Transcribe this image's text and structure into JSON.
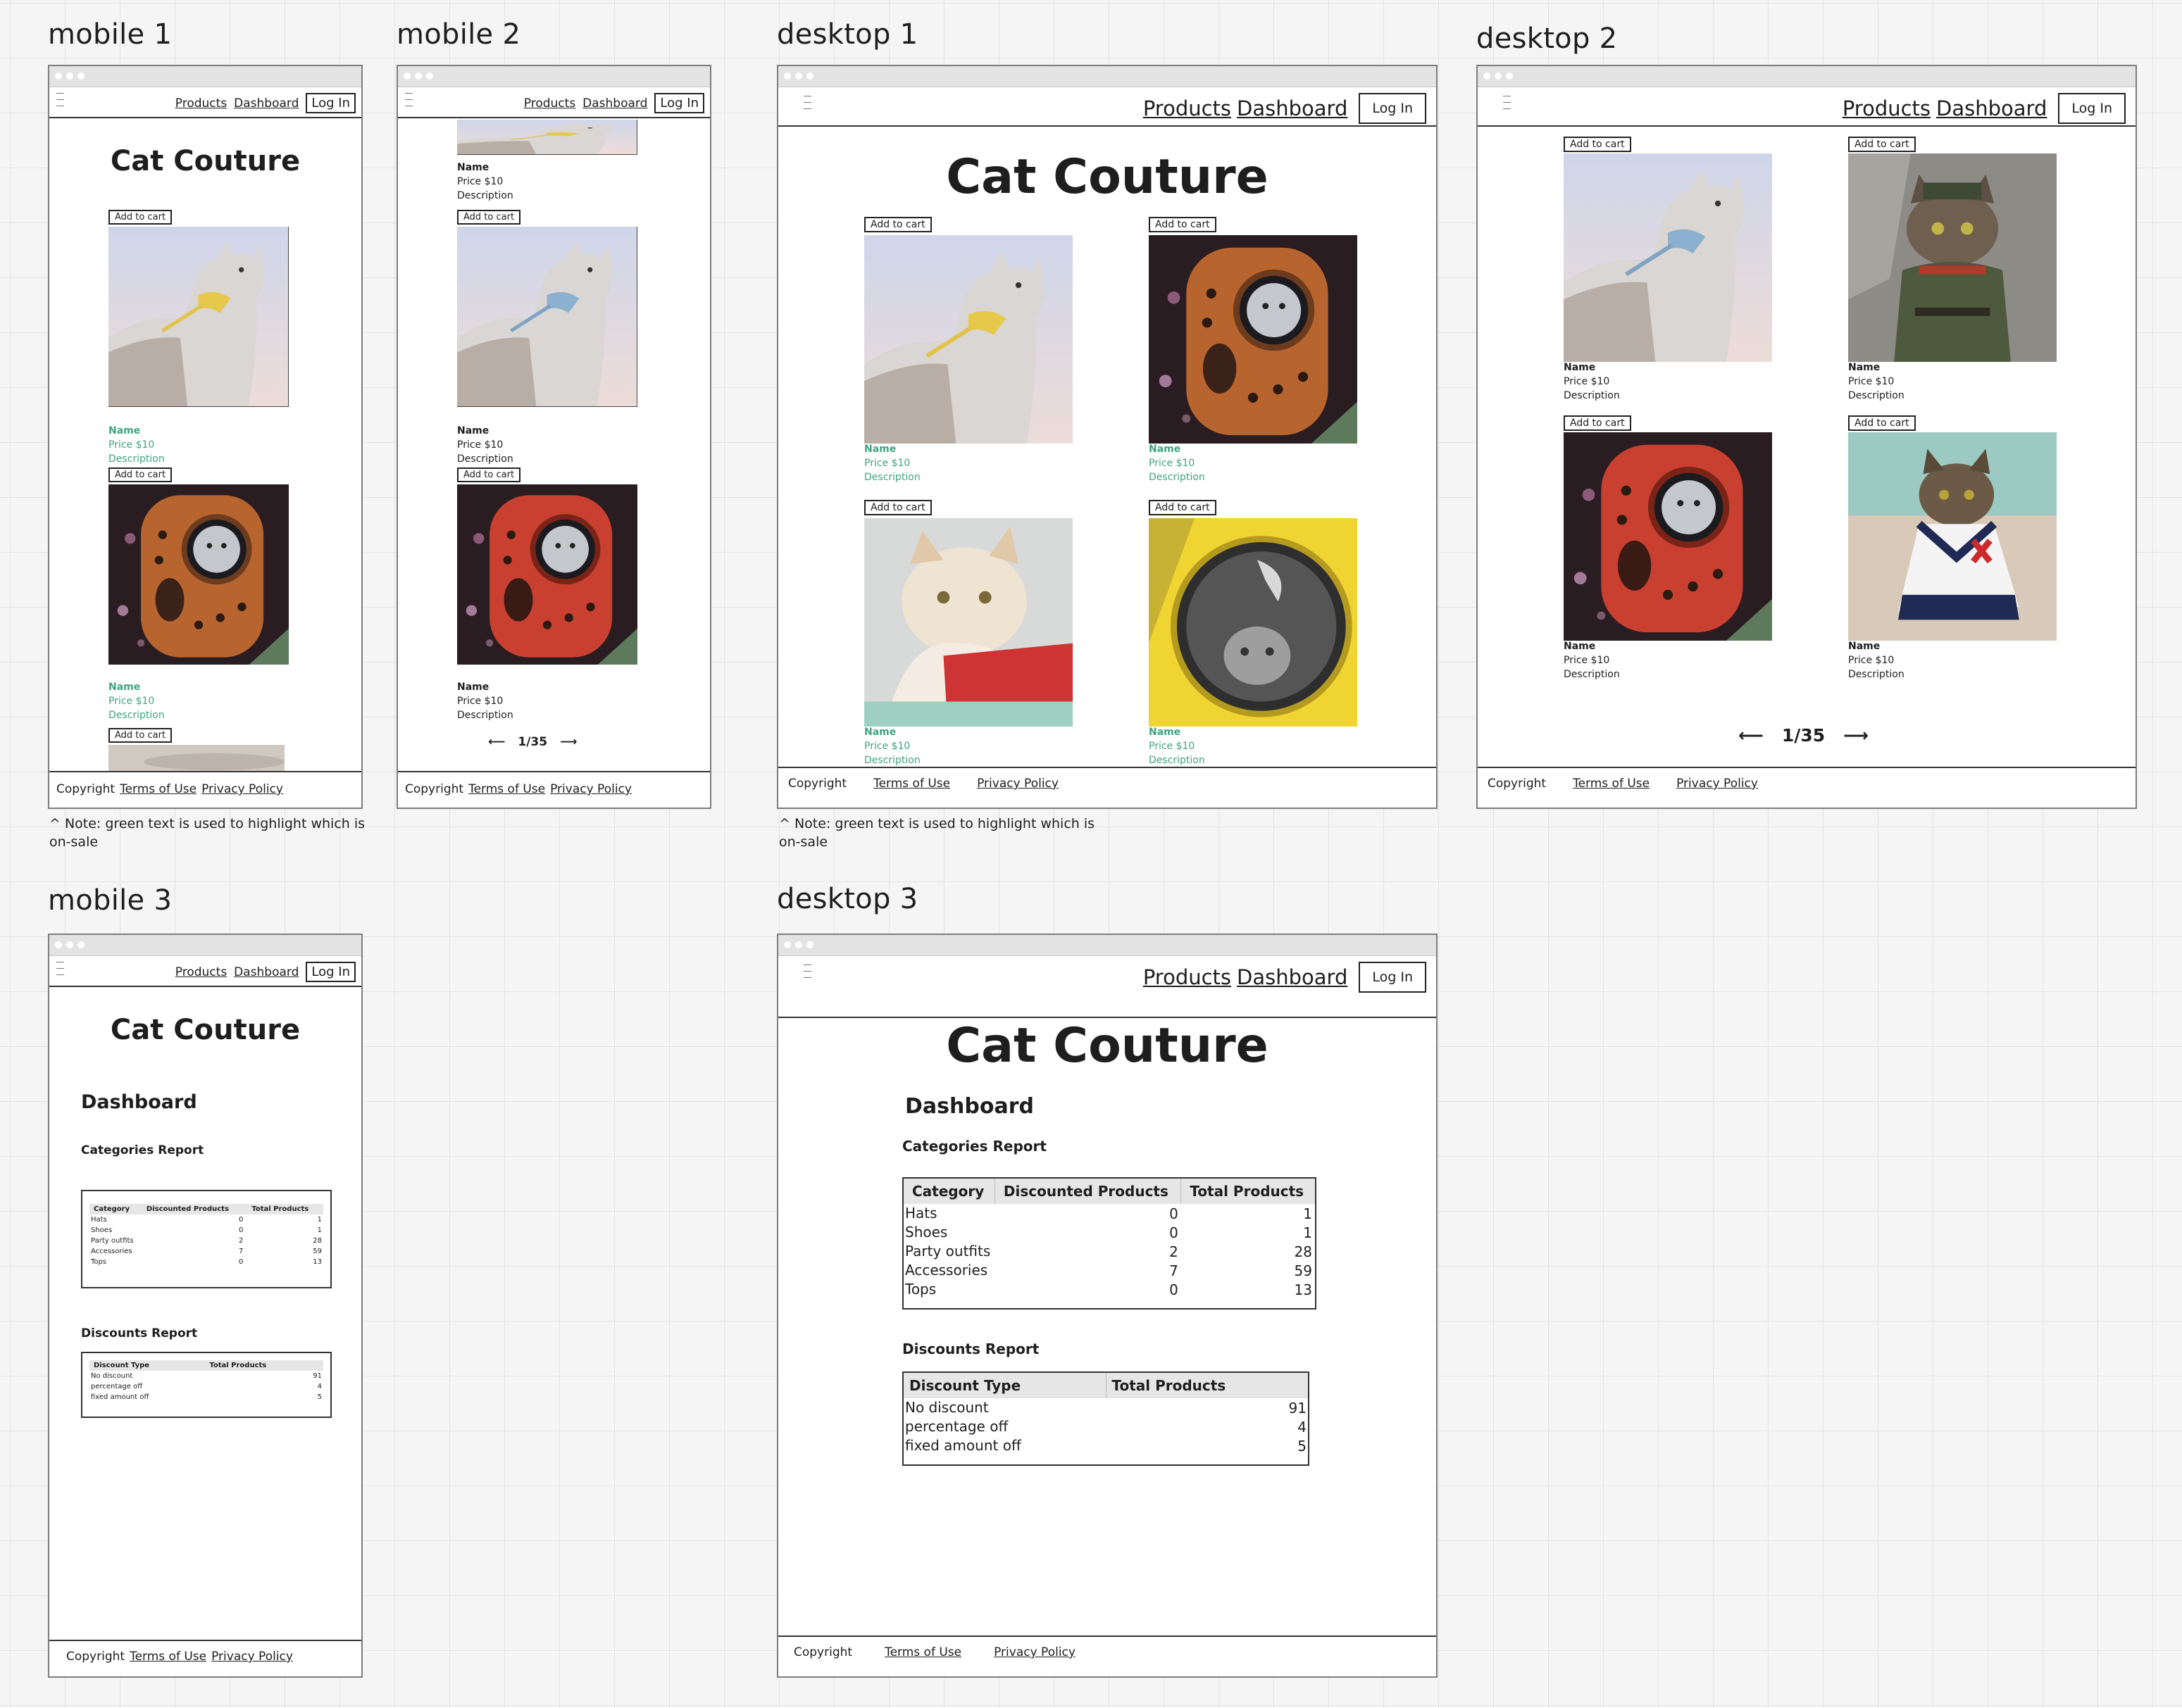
{
  "frames": {
    "mobile1": "mobile 1",
    "mobile2": "mobile 2",
    "mobile3": "mobile 3",
    "desktop1": "desktop 1",
    "desktop2": "desktop 2",
    "desktop3": "desktop 3"
  },
  "note": "^ Note: green text  is used to highlight which is on-sale",
  "nav": {
    "products": "Products",
    "dashboard": "Dashboard",
    "login": "Log In"
  },
  "site_title": "Cat Couture",
  "product": {
    "add_to_cart": "Add to cart",
    "name": "Name",
    "price": "Price $10",
    "description": "Description"
  },
  "pagination": {
    "page": "1/35"
  },
  "footer": {
    "copyright": "Copyright",
    "terms": "Terms of Use",
    "terms_padded": " Terms of Use ",
    "privacy": "Privacy Policy",
    "privacy_padded": " Privacy Policy"
  },
  "dashboard": {
    "heading": "Dashboard",
    "categories_report": {
      "title": "Categories Report",
      "headers": [
        "Category",
        "Discounted Products",
        "Total Products"
      ],
      "rows": [
        [
          "Hats",
          "0",
          "1"
        ],
        [
          "Shoes",
          "0",
          "1"
        ],
        [
          "Party outfits",
          "2",
          "28"
        ],
        [
          "Accessories",
          "7",
          "59"
        ],
        [
          "Tops",
          "0",
          "13"
        ]
      ]
    },
    "discounts_report": {
      "title": "Discounts Report",
      "headers": [
        "Discount Type",
        "Total Products"
      ],
      "rows": [
        [
          "No discount",
          "91"
        ],
        [
          "percentage off",
          "4"
        ],
        [
          "fixed amount off",
          "5"
        ]
      ]
    }
  },
  "colors": {
    "sale": "#3fa381",
    "chrome": "#e3e3e3",
    "canvas": "#f5f5f5",
    "grid": "#e4e4e4"
  }
}
